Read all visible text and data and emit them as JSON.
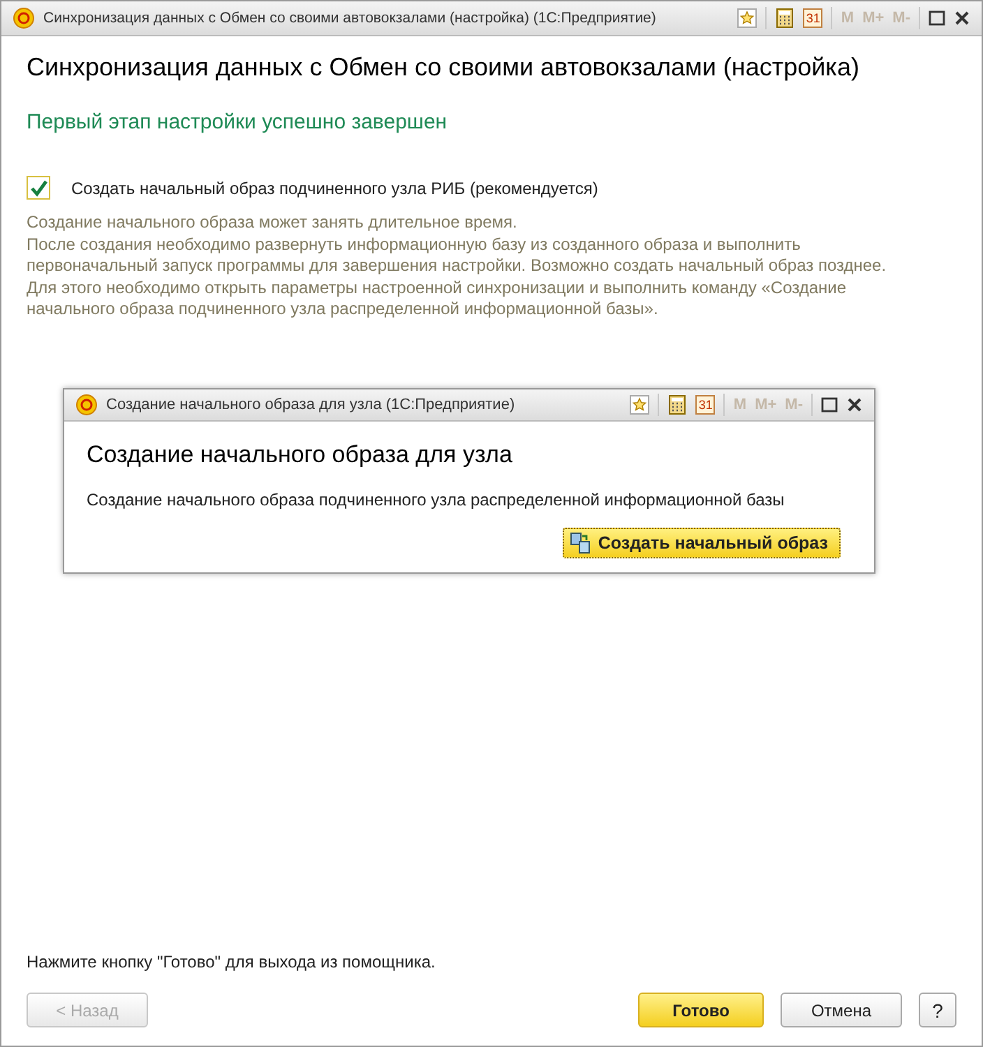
{
  "window": {
    "title": "Синхронизация данных с Обмен со своими автовокзалами (настройка)  (1С:Предприятие)",
    "calendar_day": "31",
    "memory_buttons": [
      {
        "label": "M",
        "disabled": true
      },
      {
        "label": "M+",
        "disabled": true
      },
      {
        "label": "M-",
        "disabled": true
      }
    ]
  },
  "heading": "Синхронизация данных с Обмен со своими автовокзалами (настройка)",
  "status": "Первый этап настройки успешно завершен",
  "checkbox": {
    "label": "Создать начальный образ подчиненного узла РИБ (рекомендуется)",
    "checked": true
  },
  "description": [
    "Создание начального образа может занять длительное время.",
    "После создания необходимо развернуть информационную базу из созданного образа и выполнить первоначальный запуск программы для завершения настройки. Возможно создать начальный образ позднее. Для этого необходимо открыть параметры настроенной синхронизации и выполнить команду «Создание начального образа подчиненного узла распределенной информационной базы»."
  ],
  "dialog": {
    "title": "Создание начального образа для узла  (1С:Предприятие)",
    "calendar_day": "31",
    "memory_buttons": [
      {
        "label": "M",
        "disabled": true
      },
      {
        "label": "M+",
        "disabled": true
      },
      {
        "label": "M-",
        "disabled": true
      }
    ],
    "heading": "Создание начального образа для узла",
    "text": "Создание начального образа подчиненного узла распределенной информационной базы",
    "button": "Создать начальный образ"
  },
  "hint": "Нажмите кнопку \"Готово\" для выхода из помощника.",
  "buttons": [
    {
      "label": "< Назад",
      "kind": "plain",
      "disabled": true
    },
    {
      "label": "Готово",
      "kind": "default",
      "disabled": false
    },
    {
      "label": "Отмена",
      "kind": "plain",
      "disabled": false
    },
    {
      "label": "?",
      "kind": "help",
      "disabled": false
    }
  ]
}
